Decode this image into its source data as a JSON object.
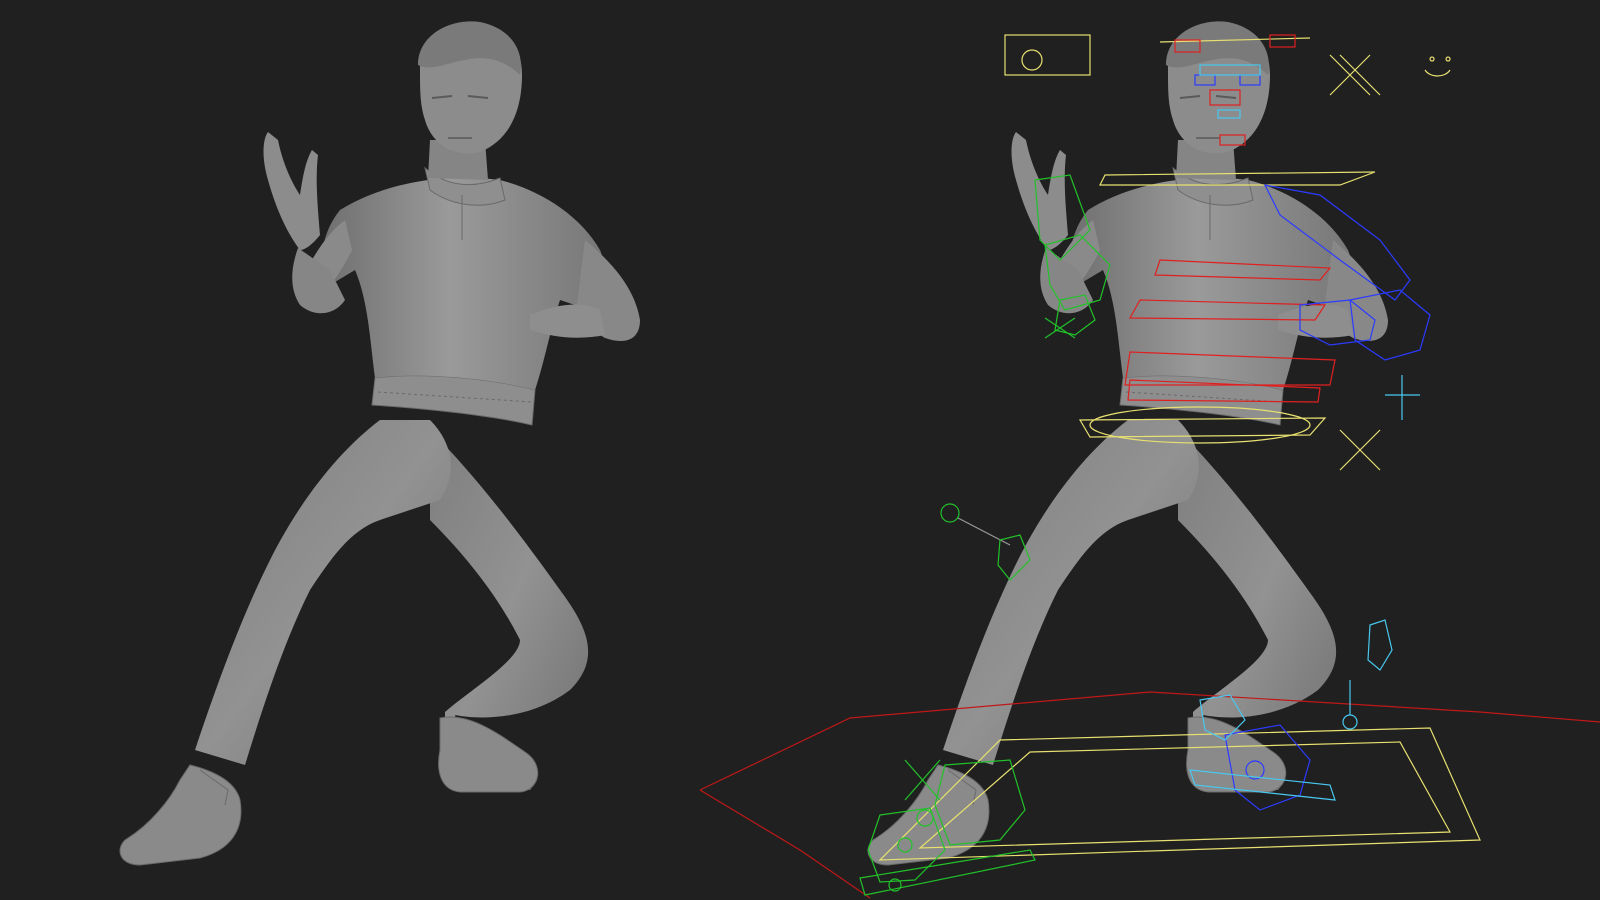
{
  "scene": {
    "background": "#202020",
    "mesh_color": "#8c8c8c",
    "mesh_shadow": "#6e6e6e",
    "mesh_highlight": "#a8a8a8",
    "panels": [
      {
        "id": "shaded-model",
        "description_icon": "character-mesh-icon"
      },
      {
        "id": "rigged-model",
        "description_icon": "rig-controls-icon"
      }
    ]
  },
  "rig_colors": {
    "left_side": "#22c22a",
    "right_side": "#2b3bff",
    "center": "#e8e070",
    "spine": "#e02020",
    "ik_light": "#48c8f0",
    "ground": "#c01818"
  }
}
